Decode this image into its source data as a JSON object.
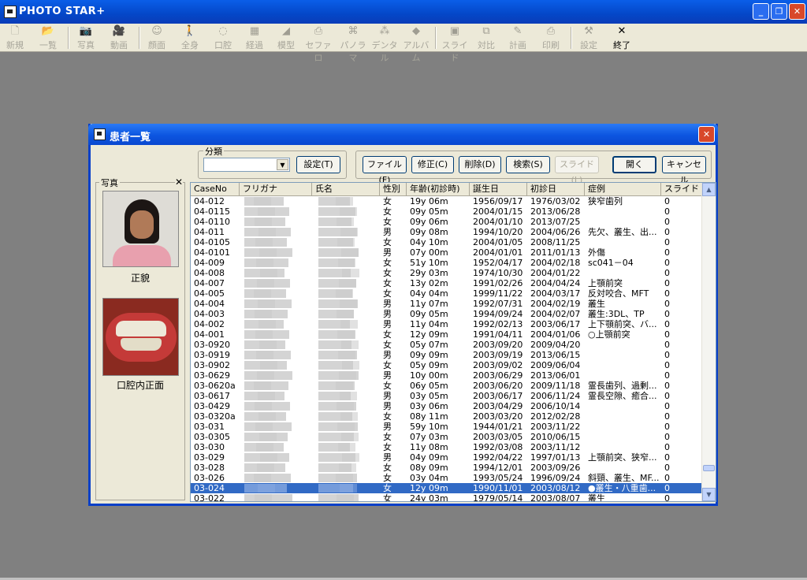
{
  "app": {
    "title": "PHOTO STAR+",
    "window_buttons": [
      "_",
      "❐",
      "✕"
    ]
  },
  "toolbar": {
    "items": [
      {
        "label": "新規",
        "icon": "new-doc-icon",
        "glyph": "🗋"
      },
      {
        "label": "一覧",
        "icon": "folder-open-icon",
        "glyph": "📂"
      },
      {
        "label": "写真",
        "icon": "camera-icon",
        "glyph": "📷"
      },
      {
        "label": "動画",
        "icon": "video-camera-icon",
        "glyph": "🎥"
      },
      {
        "label": "顔面",
        "icon": "face-icon",
        "glyph": "☺"
      },
      {
        "label": "全身",
        "icon": "person-icon",
        "glyph": "🚶"
      },
      {
        "label": "口腔",
        "icon": "mouth-icon",
        "glyph": "◌"
      },
      {
        "label": "経過",
        "icon": "grid-icon",
        "glyph": "▦"
      },
      {
        "label": "模型",
        "icon": "model-icon",
        "glyph": "◢"
      },
      {
        "label": "セファロ",
        "icon": "cephalo-icon",
        "glyph": "⎙"
      },
      {
        "label": "パノラマ",
        "icon": "binoculars-icon",
        "glyph": "⌘"
      },
      {
        "label": "デンタル",
        "icon": "tooth-network-icon",
        "glyph": "⁂"
      },
      {
        "label": "アルバム",
        "icon": "album-icon",
        "glyph": "◆"
      },
      {
        "label": "スライド",
        "icon": "projector-icon",
        "glyph": "▣"
      },
      {
        "label": "対比",
        "icon": "compare-icon",
        "glyph": "⧉"
      },
      {
        "label": "計画",
        "icon": "plan-icon",
        "glyph": "✎"
      },
      {
        "label": "印刷",
        "icon": "printer-icon",
        "glyph": "⎙"
      },
      {
        "label": "設定",
        "icon": "settings-tools-icon",
        "glyph": "⚒"
      },
      {
        "label": "終了",
        "icon": "exit-x-icon",
        "glyph": "✕"
      }
    ]
  },
  "dialog": {
    "title": "患者一覧",
    "close": "✕",
    "photo_panel": {
      "label": "写真",
      "close": "✕",
      "photo1_caption": "正貌",
      "photo2_caption": "口腔内正面"
    },
    "category": {
      "label": "分類",
      "value": "",
      "set_button": "設定(T)"
    },
    "buttons": {
      "file": "ファイル(F)",
      "edit": "修正(C)",
      "delete": "削除(D)",
      "search": "検索(S)",
      "slide": "スライド(L)",
      "open": "開く",
      "cancel": "キャンセル"
    },
    "columns": [
      "CaseNo",
      "フリガナ",
      "氏名",
      "性別",
      "年齢(初診時)",
      "誕生日",
      "初診日",
      "症例",
      "スライド"
    ],
    "rows": [
      [
        "04-012",
        "",
        "",
        "女",
        "19y 06m",
        "1956/09/17",
        "1976/03/02",
        "狭窄歯列",
        "0"
      ],
      [
        "04-0115",
        "",
        "",
        "女",
        "09y 05m",
        "2004/01/15",
        "2013/06/28",
        "",
        "0"
      ],
      [
        "04-0110",
        "",
        "",
        "女",
        "09y 06m",
        "2004/01/10",
        "2013/07/25",
        "",
        "0"
      ],
      [
        "04-011",
        "",
        "",
        "男",
        "09y 08m",
        "1994/10/20",
        "2004/06/26",
        "先欠、叢生、出...",
        "0"
      ],
      [
        "04-0105",
        "",
        "",
        "女",
        "04y 10m",
        "2004/01/05",
        "2008/11/25",
        "",
        "0"
      ],
      [
        "04-0101",
        "",
        "",
        "男",
        "07y 00m",
        "2004/01/01",
        "2011/01/13",
        "外傷",
        "0"
      ],
      [
        "04-009",
        "",
        "",
        "女",
        "51y 10m",
        "1952/04/17",
        "2004/02/18",
        "sc041－04",
        "0"
      ],
      [
        "04-008",
        "",
        "",
        "女",
        "29y 03m",
        "1974/10/30",
        "2004/01/22",
        "",
        "0"
      ],
      [
        "04-007",
        "",
        "",
        "女",
        "13y 02m",
        "1991/02/26",
        "2004/04/24",
        "上顎前突",
        "0"
      ],
      [
        "04-005",
        "",
        "",
        "女",
        "04y 04m",
        "1999/11/22",
        "2004/03/17",
        "反対咬合、MFT",
        "0"
      ],
      [
        "04-004",
        "",
        "",
        "男",
        "11y 07m",
        "1992/07/31",
        "2004/02/19",
        "叢生",
        "0"
      ],
      [
        "04-003",
        "",
        "",
        "男",
        "09y 05m",
        "1994/09/24",
        "2004/02/07",
        "叢生:3DL、TP",
        "0"
      ],
      [
        "04-002",
        "",
        "",
        "男",
        "11y 04m",
        "1992/02/13",
        "2003/06/17",
        "上下顎前突、バ...",
        "0"
      ],
      [
        "04-001",
        "",
        "",
        "女",
        "12y 09m",
        "1991/04/11",
        "2004/01/06",
        "○上顎前突",
        "0"
      ],
      [
        "03-0920",
        "",
        "",
        "女",
        "05y 07m",
        "2003/09/20",
        "2009/04/20",
        "",
        "0"
      ],
      [
        "03-0919",
        "",
        "",
        "男",
        "09y 09m",
        "2003/09/19",
        "2013/06/15",
        "",
        "0"
      ],
      [
        "03-0902",
        "",
        "",
        "女",
        "05y 09m",
        "2003/09/02",
        "2009/06/04",
        "",
        "0"
      ],
      [
        "03-0629",
        "",
        "",
        "男",
        "10y 00m",
        "2003/06/29",
        "2013/06/01",
        "",
        "0"
      ],
      [
        "03-0620a",
        "",
        "",
        "女",
        "06y 05m",
        "2003/06/20",
        "2009/11/18",
        "霊長歯列、過剰...",
        "0"
      ],
      [
        "03-0617",
        "",
        "",
        "男",
        "03y 05m",
        "2003/06/17",
        "2006/11/24",
        "霊長空隙、癒合...",
        "0"
      ],
      [
        "03-0429",
        "",
        "",
        "男",
        "03y 06m",
        "2003/04/29",
        "2006/10/14",
        "",
        "0"
      ],
      [
        "03-0320a",
        "",
        "",
        "女",
        "08y 11m",
        "2003/03/20",
        "2012/02/28",
        "",
        "0"
      ],
      [
        "03-031",
        "",
        "",
        "男",
        "59y 10m",
        "1944/01/21",
        "2003/11/22",
        "",
        "0"
      ],
      [
        "03-0305",
        "",
        "",
        "女",
        "07y 03m",
        "2003/03/05",
        "2010/06/15",
        "",
        "0"
      ],
      [
        "03-030",
        "",
        "",
        "女",
        "11y 08m",
        "1992/03/08",
        "2003/11/12",
        "",
        "0"
      ],
      [
        "03-029",
        "",
        "",
        "男",
        "04y 09m",
        "1992/04/22",
        "1997/01/13",
        "上顎前突、狭窄...",
        "0"
      ],
      [
        "03-028",
        "",
        "",
        "女",
        "08y 09m",
        "1994/12/01",
        "2003/09/26",
        "",
        "0"
      ],
      [
        "03-026",
        "",
        "",
        "女",
        "03y 04m",
        "1993/05/24",
        "1996/09/24",
        "斜頸、叢生、MF...",
        "0"
      ],
      [
        "03-024",
        "",
        "",
        "女",
        "12y 09m",
        "1990/11/01",
        "2003/08/12",
        "●叢生・八重歯...",
        "0"
      ],
      [
        "03-022",
        "",
        "",
        "女",
        "24y 03m",
        "1979/05/14",
        "2003/08/07",
        "叢生",
        "0"
      ]
    ],
    "selected_row": 28
  },
  "colors": {
    "title_bar": "#0447c8",
    "selection": "#316ac5",
    "window_bg": "#ece9d8",
    "desktop": "#808080"
  }
}
